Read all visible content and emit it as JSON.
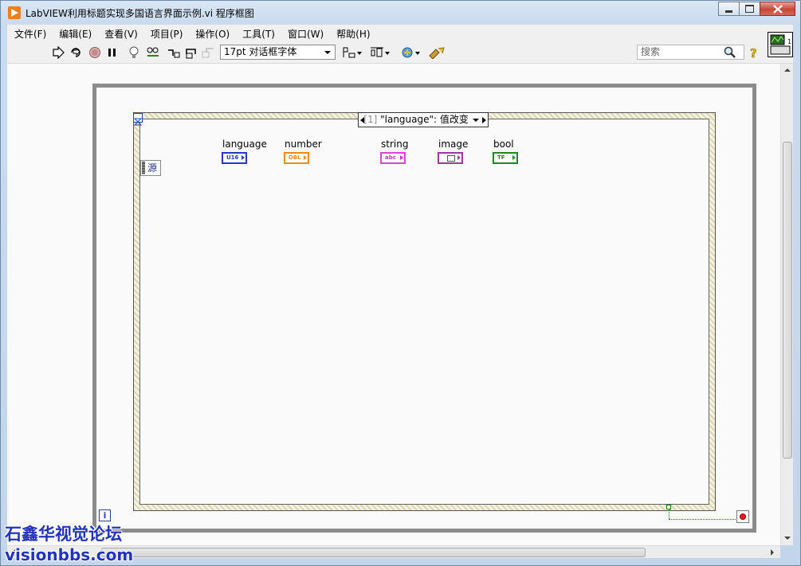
{
  "window": {
    "title": "LabVIEW利用标题实现多国语言界面示例.vi 程序框图"
  },
  "menu": [
    {
      "label": "文件(F)"
    },
    {
      "label": "编辑(E)"
    },
    {
      "label": "查看(V)"
    },
    {
      "label": "项目(P)"
    },
    {
      "label": "操作(O)"
    },
    {
      "label": "工具(T)"
    },
    {
      "label": "窗口(W)"
    },
    {
      "label": "帮助(H)"
    }
  ],
  "toolbar": {
    "font_value": "17pt 对话框字体",
    "search_placeholder": "搜索"
  },
  "diagram": {
    "event_case_index": "[1]",
    "event_case_label": "\"language\": 值改变",
    "source_label": "源",
    "iteration_label": "i",
    "controls": [
      {
        "label": "language",
        "type_label": "U16",
        "color": "#2a35c9"
      },
      {
        "label": "number",
        "type_label": "DBL",
        "color": "#f08a18"
      },
      {
        "label": "string",
        "type_label": "abc",
        "color": "#e040e0"
      },
      {
        "label": "image",
        "type_label": "",
        "color": "#9a3aa0"
      },
      {
        "label": "bool",
        "type_label": "TF",
        "color": "#1a8a1a"
      }
    ]
  },
  "watermark": {
    "line1": "石鑫华视觉论坛",
    "line2": "visionbbs.com"
  }
}
